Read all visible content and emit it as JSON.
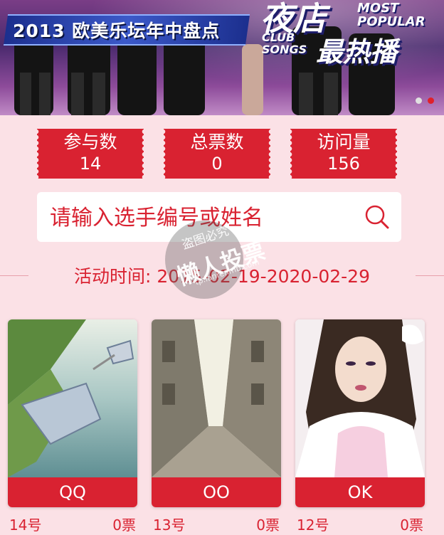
{
  "banner": {
    "title": "2013 欧美乐坛年中盘点",
    "club_big": "夜店",
    "most_popular_line1": "MOST",
    "most_popular_line2": "POPULAR",
    "club_songs_line1": "CLUB",
    "club_songs_line2": "SONGS",
    "hot": "最热播",
    "slides": 2,
    "active_slide": 2
  },
  "stats": [
    {
      "label": "参与数",
      "value": "14"
    },
    {
      "label": "总票数",
      "value": "0"
    },
    {
      "label": "访问量",
      "value": "156"
    }
  ],
  "search": {
    "placeholder": "请输入选手编号或姓名",
    "icon": "search-icon"
  },
  "activity_time": "活动时间: 2015-02-19-2020-02-29",
  "watermark": {
    "line1": "盗图必究",
    "line2": "懒人投票",
    "line3": "tp.lanrenmb.com"
  },
  "candidates": [
    {
      "name": "QQ",
      "number": "14号",
      "votes": "0票"
    },
    {
      "name": "OO",
      "number": "13号",
      "votes": "0票"
    },
    {
      "name": "OK",
      "number": "12号",
      "votes": "0票"
    }
  ],
  "colors": {
    "accent": "#d92231",
    "background": "#fbe1e6"
  }
}
